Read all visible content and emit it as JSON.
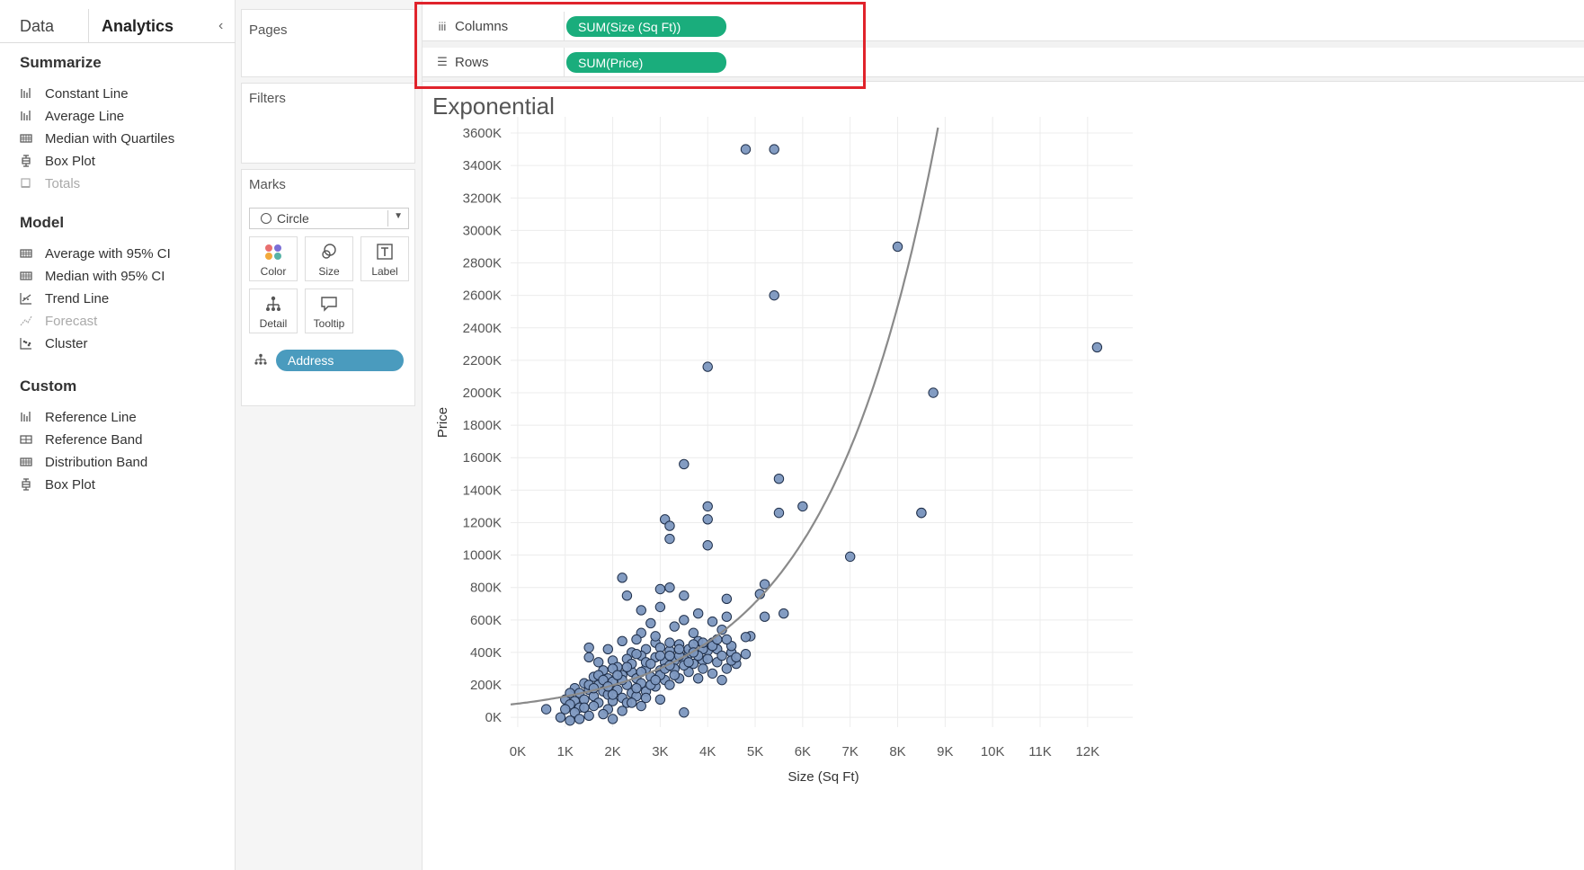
{
  "analytics_pane": {
    "tabs": [
      "Data",
      "Analytics"
    ],
    "collapse_icon": "chevron-left-icon",
    "sections": [
      {
        "title": "Summarize",
        "items": [
          {
            "label": "Constant Line",
            "icon": "reference-line-icon",
            "enabled": true
          },
          {
            "label": "Average Line",
            "icon": "reference-line-icon",
            "enabled": true
          },
          {
            "label": "Median with Quartiles",
            "icon": "distribution-band-icon",
            "enabled": true
          },
          {
            "label": "Box Plot",
            "icon": "box-plot-icon",
            "enabled": true
          },
          {
            "label": "Totals",
            "icon": "totals-icon",
            "enabled": false
          }
        ]
      },
      {
        "title": "Model",
        "items": [
          {
            "label": "Average with 95% CI",
            "icon": "distribution-band-icon",
            "enabled": true
          },
          {
            "label": "Median with 95% CI",
            "icon": "distribution-band-icon",
            "enabled": true
          },
          {
            "label": "Trend Line",
            "icon": "trend-line-icon",
            "enabled": true
          },
          {
            "label": "Forecast",
            "icon": "forecast-icon",
            "enabled": false
          },
          {
            "label": "Cluster",
            "icon": "cluster-icon",
            "enabled": true
          }
        ]
      },
      {
        "title": "Custom",
        "items": [
          {
            "label": "Reference Line",
            "icon": "reference-line-icon",
            "enabled": true
          },
          {
            "label": "Reference Band",
            "icon": "reference-band-icon",
            "enabled": true
          },
          {
            "label": "Distribution Band",
            "icon": "distribution-band-icon",
            "enabled": true
          },
          {
            "label": "Box Plot",
            "icon": "box-plot-icon",
            "enabled": true
          }
        ]
      }
    ]
  },
  "cards": {
    "pages": "Pages",
    "filters": "Filters",
    "marks": {
      "title": "Marks",
      "type": "Circle",
      "buttons": [
        "Color",
        "Size",
        "Label",
        "Detail",
        "Tooltip"
      ],
      "detail_field": "Address"
    }
  },
  "shelves": {
    "columns_label": "Columns",
    "columns_pill": "SUM(Size (Sq Ft))",
    "rows_label": "Rows",
    "rows_pill": "SUM(Price)"
  },
  "colors": {
    "highlight": "#e0232b",
    "measure_pill": "#1aad7c",
    "dimension_pill": "#4a9bbe",
    "point_fill": "#7c97bf",
    "point_stroke": "#1f2f4a",
    "trend_line": "#8a8a8a"
  },
  "chart_data": {
    "type": "scatter",
    "title": "Exponential",
    "xlabel": "Size (Sq Ft)",
    "ylabel": "Price",
    "xlim": [
      -150,
      12950
    ],
    "ylim": [
      -60,
      3700
    ],
    "x_ticks": [
      "0K",
      "1K",
      "2K",
      "3K",
      "4K",
      "5K",
      "6K",
      "7K",
      "8K",
      "9K",
      "10K",
      "11K",
      "12K"
    ],
    "y_ticks": [
      "0K",
      "200K",
      "400K",
      "600K",
      "800K",
      "1000K",
      "1200K",
      "1400K",
      "1600K",
      "1800K",
      "2000K",
      "2200K",
      "2400K",
      "2600K",
      "2800K",
      "3000K",
      "3200K",
      "3400K",
      "3600K"
    ],
    "grid": true,
    "trend_line": {
      "type": "exponential",
      "a": 84.5,
      "b": 0.000425
    },
    "points": [
      [
        4800,
        3500
      ],
      [
        5400,
        3500
      ],
      [
        8000,
        2900
      ],
      [
        5400,
        2600
      ],
      [
        12200,
        2280
      ],
      [
        4000,
        2160
      ],
      [
        8750,
        2000
      ],
      [
        3500,
        1560
      ],
      [
        5500,
        1470
      ],
      [
        4000,
        1300
      ],
      [
        6000,
        1300
      ],
      [
        5500,
        1260
      ],
      [
        8500,
        1260
      ],
      [
        8500,
        1260
      ],
      [
        3100,
        1220
      ],
      [
        4000,
        1220
      ],
      [
        3200,
        1180
      ],
      [
        3200,
        1100
      ],
      [
        4000,
        1060
      ],
      [
        7000,
        990
      ],
      [
        2200,
        860
      ],
      [
        3200,
        800
      ],
      [
        3000,
        790
      ],
      [
        5200,
        820
      ],
      [
        5100,
        760
      ],
      [
        2300,
        750
      ],
      [
        3500,
        750
      ],
      [
        4400,
        730
      ],
      [
        3000,
        680
      ],
      [
        2600,
        660
      ],
      [
        3800,
        640
      ],
      [
        5600,
        640
      ],
      [
        4400,
        620
      ],
      [
        5200,
        620
      ],
      [
        3500,
        600
      ],
      [
        4100,
        590
      ],
      [
        2800,
        580
      ],
      [
        3300,
        560
      ],
      [
        4300,
        540
      ],
      [
        2600,
        520
      ],
      [
        3700,
        520
      ],
      [
        4900,
        500
      ],
      [
        4800,
        495
      ],
      [
        2200,
        470
      ],
      [
        2500,
        480
      ],
      [
        2900,
        460
      ],
      [
        3000,
        430
      ],
      [
        3400,
        450
      ],
      [
        3800,
        470
      ],
      [
        4100,
        460
      ],
      [
        1500,
        430
      ],
      [
        1500,
        370
      ],
      [
        1900,
        420
      ],
      [
        2400,
        400
      ],
      [
        2700,
        420
      ],
      [
        3200,
        410
      ],
      [
        3600,
        390
      ],
      [
        4000,
        410
      ],
      [
        4500,
        400
      ],
      [
        4800,
        390
      ],
      [
        1700,
        340
      ],
      [
        2000,
        350
      ],
      [
        2300,
        360
      ],
      [
        2600,
        380
      ],
      [
        2900,
        370
      ],
      [
        3100,
        340
      ],
      [
        3300,
        350
      ],
      [
        3500,
        360
      ],
      [
        3700,
        330
      ],
      [
        3900,
        350
      ],
      [
        4200,
        340
      ],
      [
        4600,
        330
      ],
      [
        4400,
        300
      ],
      [
        1800,
        290
      ],
      [
        2100,
        310
      ],
      [
        2400,
        280
      ],
      [
        2700,
        300
      ],
      [
        3000,
        290
      ],
      [
        3300,
        300
      ],
      [
        3600,
        280
      ],
      [
        4100,
        270
      ],
      [
        4300,
        230
      ],
      [
        1600,
        250
      ],
      [
        1900,
        240
      ],
      [
        2200,
        260
      ],
      [
        2500,
        240
      ],
      [
        2800,
        250
      ],
      [
        3100,
        230
      ],
      [
        3400,
        240
      ],
      [
        3800,
        240
      ],
      [
        1400,
        210
      ],
      [
        1700,
        200
      ],
      [
        2000,
        220
      ],
      [
        2300,
        200
      ],
      [
        2600,
        210
      ],
      [
        2900,
        190
      ],
      [
        3200,
        200
      ],
      [
        1200,
        180
      ],
      [
        1500,
        170
      ],
      [
        1800,
        160
      ],
      [
        2100,
        170
      ],
      [
        2400,
        150
      ],
      [
        2700,
        160
      ],
      [
        1300,
        150
      ],
      [
        1600,
        130
      ],
      [
        1900,
        140
      ],
      [
        2200,
        120
      ],
      [
        2500,
        130
      ],
      [
        1000,
        110
      ],
      [
        1200,
        100
      ],
      [
        1400,
        110
      ],
      [
        1700,
        90
      ],
      [
        2000,
        100
      ],
      [
        2300,
        90
      ],
      [
        1100,
        80
      ],
      [
        1300,
        60
      ],
      [
        1600,
        70
      ],
      [
        1900,
        50
      ],
      [
        2200,
        40
      ],
      [
        1000,
        50
      ],
      [
        1200,
        30
      ],
      [
        600,
        50
      ],
      [
        1300,
        -10
      ],
      [
        1500,
        10
      ],
      [
        2000,
        -10
      ],
      [
        3500,
        30
      ],
      [
        900,
        0
      ],
      [
        1100,
        -20
      ],
      [
        1800,
        20
      ],
      [
        2600,
        70
      ],
      [
        3000,
        110
      ],
      [
        2700,
        120
      ],
      [
        3400,
        380
      ],
      [
        3900,
        420
      ],
      [
        4200,
        420
      ],
      [
        4000,
        360
      ],
      [
        3600,
        420
      ],
      [
        3200,
        460
      ],
      [
        2900,
        500
      ],
      [
        3700,
        450
      ],
      [
        4300,
        380
      ],
      [
        4500,
        350
      ],
      [
        3900,
        300
      ],
      [
        2400,
        330
      ],
      [
        2000,
        300
      ],
      [
        1700,
        260
      ],
      [
        2500,
        180
      ],
      [
        2800,
        200
      ],
      [
        3000,
        260
      ],
      [
        3300,
        260
      ],
      [
        3500,
        320
      ],
      [
        3800,
        380
      ],
      [
        4600,
        370
      ],
      [
        4100,
        440
      ],
      [
        3200,
        380
      ],
      [
        2700,
        340
      ],
      [
        2200,
        230
      ],
      [
        1500,
        200
      ],
      [
        1100,
        150
      ],
      [
        2000,
        140
      ],
      [
        2400,
        90
      ],
      [
        2900,
        230
      ],
      [
        3600,
        340
      ],
      [
        3000,
        380
      ],
      [
        4200,
        480
      ],
      [
        4500,
        440
      ],
      [
        1800,
        230
      ],
      [
        2600,
        280
      ],
      [
        3400,
        420
      ],
      [
        2100,
        260
      ],
      [
        1400,
        60
      ],
      [
        3100,
        300
      ],
      [
        3700,
        400
      ],
      [
        2300,
        310
      ],
      [
        1900,
        190
      ],
      [
        2800,
        330
      ],
      [
        3900,
        460
      ],
      [
        4400,
        480
      ],
      [
        2500,
        390
      ],
      [
        3200,
        320
      ],
      [
        1600,
        180
      ]
    ]
  }
}
